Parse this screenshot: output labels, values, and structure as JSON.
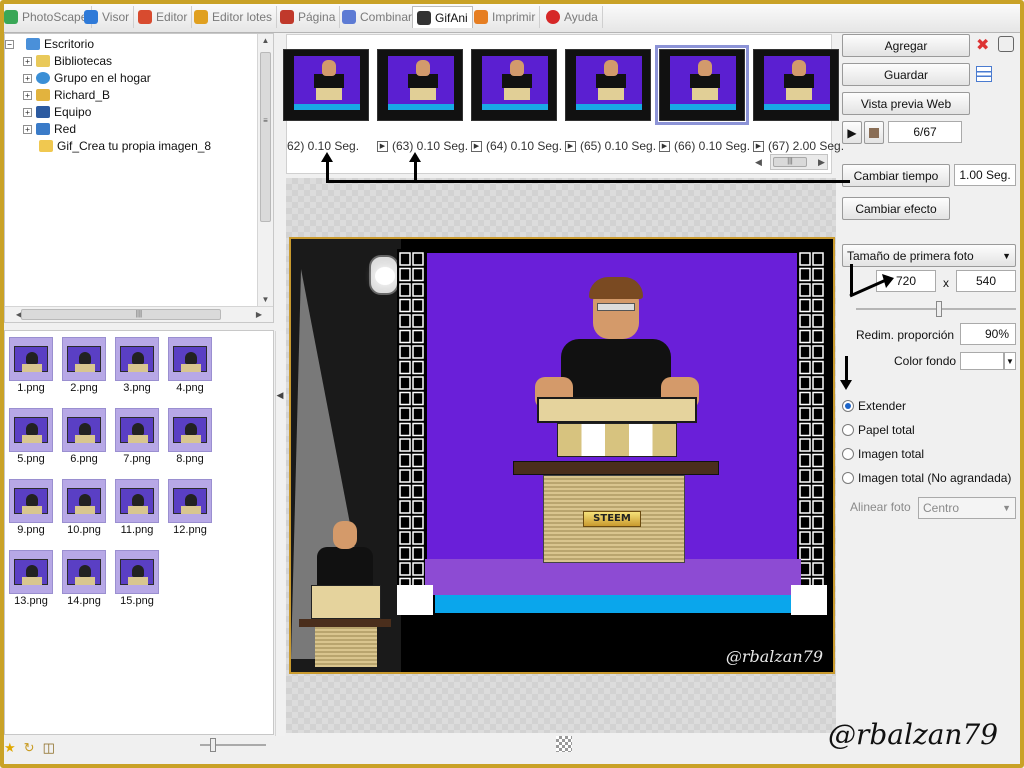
{
  "tabs": [
    {
      "label": "PhotoScape",
      "color": "#3aa757"
    },
    {
      "label": "Visor",
      "color": "#2f7ad8"
    },
    {
      "label": "Editor",
      "color": "#d84b2f"
    },
    {
      "label": "Editor lotes",
      "color": "#e0a020"
    },
    {
      "label": "Página",
      "color": "#c0392b"
    },
    {
      "label": "Combinar",
      "color": "#5d7bd4"
    },
    {
      "label": "GifAni",
      "color": "#333333"
    },
    {
      "label": "Imprimir",
      "color": "#e67e22"
    },
    {
      "label": "Ayuda",
      "color": "#d62828"
    }
  ],
  "tree": {
    "items": [
      {
        "label": "Escritorio",
        "expander": ""
      },
      {
        "label": "Bibliotecas",
        "expander": "+"
      },
      {
        "label": "Grupo en el hogar",
        "expander": "+"
      },
      {
        "label": "Richard_B",
        "expander": "+"
      },
      {
        "label": "Equipo",
        "expander": "+"
      },
      {
        "label": "Red",
        "expander": "+"
      },
      {
        "label": "Gif_Crea tu propia imagen_8",
        "expander": ""
      }
    ]
  },
  "thumbnails": [
    "1.png",
    "2.png",
    "3.png",
    "4.png",
    "5.png",
    "6.png",
    "7.png",
    "8.png",
    "9.png",
    "10.png",
    "11.png",
    "12.png",
    "13.png",
    "14.png",
    "15.png"
  ],
  "frames": [
    {
      "label": "62) 0.10 Seg."
    },
    {
      "label": "(63) 0.10 Seg."
    },
    {
      "label": "(64) 0.10 Seg."
    },
    {
      "label": "(65) 0.10 Seg."
    },
    {
      "label": "(66) 0.10 Seg."
    },
    {
      "label": "(67) 2.00 Seg."
    }
  ],
  "right_panel": {
    "agregar": "Agregar",
    "guardar": "Guardar",
    "vista_previa": "Vista previa Web",
    "counter": "6/67",
    "cambiar_tiempo": "Cambiar tiempo",
    "tiempo_value": "1.00 Seg.",
    "cambiar_efecto": "Cambiar efecto",
    "tamano_select": "Tamaño de primera foto",
    "width": "720",
    "x_label": "x",
    "height": "540",
    "redim_label": "Redim. proporción",
    "redim_value": "90%",
    "color_fondo": "Color fondo",
    "radios": [
      {
        "label": "Extender",
        "checked": true
      },
      {
        "label": "Papel total",
        "checked": false
      },
      {
        "label": "Imagen total",
        "checked": false
      },
      {
        "label": "Imagen total (No agrandada)",
        "checked": false
      }
    ],
    "alinear_label": "Alinear foto",
    "alinear_value": "Centro"
  },
  "scene": {
    "steem": "STEEM",
    "watermark": "@rbalzan79"
  },
  "watermark": "@rbalzan79",
  "colors": {
    "frame": "#c9a227",
    "stage": "#6a1fd9",
    "accent": "#1d64c8"
  }
}
